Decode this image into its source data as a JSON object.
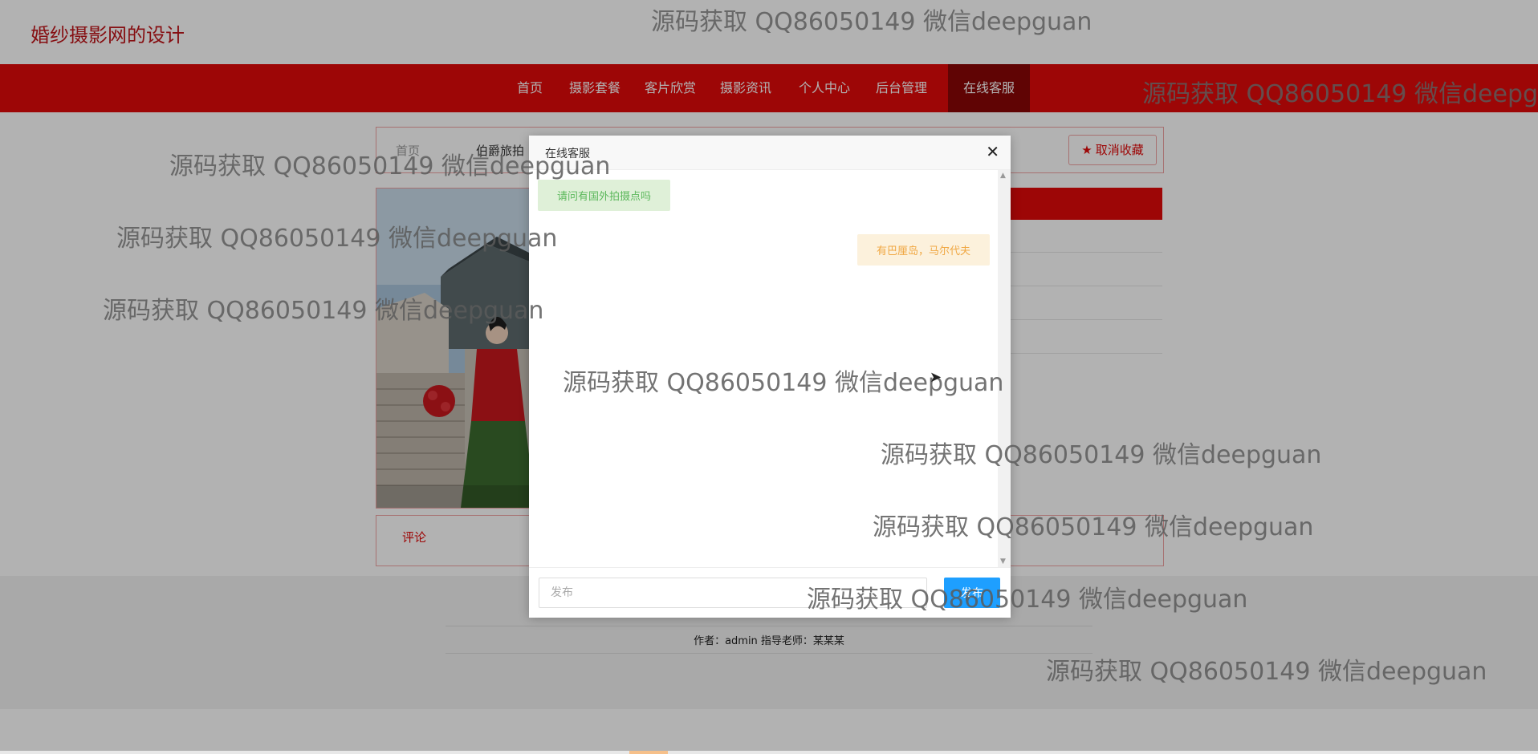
{
  "site": {
    "title": "婚纱摄影网的设计"
  },
  "nav": {
    "items": [
      {
        "label": "首页"
      },
      {
        "label": "摄影套餐"
      },
      {
        "label": "客片欣赏"
      },
      {
        "label": "摄影资讯"
      },
      {
        "label": "个人中心"
      },
      {
        "label": "后台管理"
      },
      {
        "label": "在线客服",
        "active": true
      }
    ]
  },
  "breadcrumb": {
    "home": "首页",
    "current": "伯爵旅拍"
  },
  "favorite_button": {
    "label": "取消收藏"
  },
  "comment": {
    "tab": "评论"
  },
  "footer": {
    "credits": "作者：admin 指导老师：某某某"
  },
  "chat_modal": {
    "title": "在线客服",
    "messages": [
      {
        "side": "user",
        "text": "请问有国外拍摄点吗"
      },
      {
        "side": "staff",
        "text": "有巴厘岛，马尔代夫"
      }
    ],
    "input_placeholder": "发布",
    "send_label": "发布"
  },
  "watermark": {
    "text": "源码获取 QQ86050149 微信deepguan"
  },
  "colors": {
    "brand_red": "#e10a0a",
    "active_nav": "#8a0606",
    "send_blue": "#1e9fff"
  }
}
